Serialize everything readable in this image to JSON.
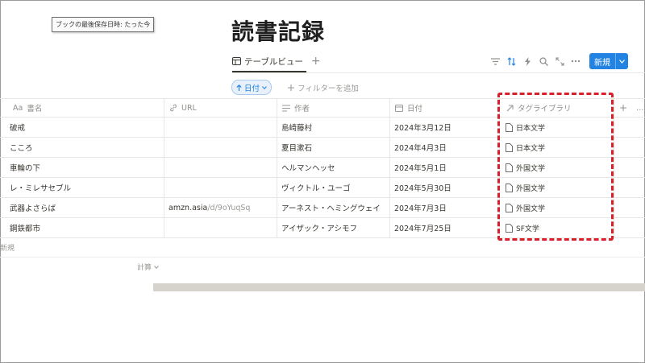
{
  "tooltip": "ブックの最後保存日時: たった今",
  "page_title": "読書記録",
  "view_tab": "テーブルビュー",
  "view_add": "+",
  "new_button": "新規",
  "sort_label": "日付",
  "add_filter": "フィルターを追加",
  "columns": {
    "title": "書名",
    "title_prefix": "Aa",
    "url": "URL",
    "author": "作者",
    "date": "日付",
    "tag": "タグライブラリ",
    "add": "+",
    "more": "…"
  },
  "rows": [
    {
      "title": "破戒",
      "url_host": "",
      "url_path": "",
      "author": "島崎藤村",
      "date": "2024年3月12日",
      "tag": "日本文学"
    },
    {
      "title": "こころ",
      "url_host": "",
      "url_path": "",
      "author": "夏目漱石",
      "date": "2024年4月3日",
      "tag": "日本文学"
    },
    {
      "title": "車輪の下",
      "url_host": "",
      "url_path": "",
      "author": "ヘルマンヘッセ",
      "date": "2024年5月1日",
      "tag": "外国文学"
    },
    {
      "title": "レ・ミレサセブル",
      "url_host": "",
      "url_path": "",
      "author": "ヴィクトル・ユーゴ",
      "date": "2024年5月30日",
      "tag": "外国文学"
    },
    {
      "title": "武器よさらば",
      "url_host": "amzn.asia",
      "url_path": "/d/9oYuqSq",
      "author": "アーネスト・ヘミングウェイ",
      "date": "2024年7月3日",
      "tag": "外国文学"
    },
    {
      "title": "鋼鉄都市",
      "url_host": "",
      "url_path": "",
      "author": "アイザック・アシモフ",
      "date": "2024年7月25日",
      "tag": "SF文学"
    }
  ],
  "new_row": "新規",
  "calc": "計算",
  "colors": {
    "accent": "#2383e2",
    "highlight": "#d9202a"
  }
}
